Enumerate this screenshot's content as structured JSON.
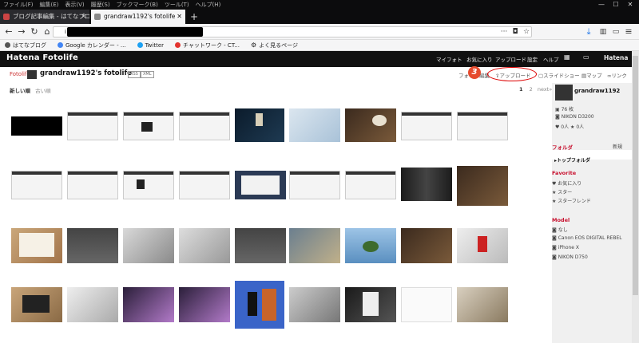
{
  "menu": [
    "ファイル(F)",
    "編集(E)",
    "表示(V)",
    "履歴(S)",
    "ブックマーク(B)",
    "ツール(T)",
    "ヘルプ(H)"
  ],
  "tabs": [
    {
      "label": "ブログ記事編集 - はてなブログ",
      "active": false
    },
    {
      "label": "grandraw1192's fotolife",
      "active": true
    }
  ],
  "new_tab": "+",
  "url_prefix": "i",
  "bookmarks": [
    "はてなブログ",
    "Google カレンダー - ...",
    "Twitter",
    "チャットワーク - CT...",
    "よく見るページ"
  ],
  "site": {
    "logo": "Hatena Fotolife",
    "header_links": [
      "マイフォト",
      "お気に入り",
      "アップロード",
      "設定",
      "ヘルプ"
    ],
    "hatena_label": "Hatena"
  },
  "subheader": {
    "crumb": "Fotolife",
    "title": "grandraw1192's fotolife",
    "tags": [
      "RSS",
      "XML"
    ],
    "tools": [
      "フォト",
      "編集",
      "アップロード",
      "スライドショー",
      "マップ",
      "リンク"
    ],
    "annotation_number": "3"
  },
  "sort": {
    "newest": "新しい順",
    "oldest": "古い順"
  },
  "pager": {
    "current": "1",
    "page2": "2",
    "next": "next»"
  },
  "sidebar": {
    "user": "grandraw1192",
    "count": "76 枚",
    "camera": "NIKON D3200",
    "stat1": "0人",
    "stat2": "0人",
    "folder_head": "フォルダ",
    "new_folder": "新規",
    "folder": "トップフォルダ",
    "favorite_head": "Favorite",
    "favorites": [
      "お気に入り",
      "スター",
      "スターフレンド"
    ],
    "model_head": "Model",
    "models": [
      "なし",
      "Canon EOS DIGITAL REBEL",
      "iPhone X",
      "NIKON D750"
    ]
  },
  "thumbnails": [
    "black-image",
    "website-screenshot",
    "website-screenshot",
    "website-screenshot",
    "paper-tag-photo",
    "flowchart-photo",
    "photo-with-text",
    "bicycle-photo",
    "website-screenshot",
    "website-screenshot",
    "website-screenshot",
    "website-screenshot",
    "website-screenshot",
    "website-screenshot",
    "website-screenshot",
    "website-screenshot",
    "website-screenshot",
    "business-suit-photo",
    "photo-with-text",
    "notebook-photo",
    "crowd-photo",
    "desk-photo",
    "desk-photo",
    "crowd-photo",
    "woman-with-text",
    "island-photo",
    "bicycle-photo",
    "flower-pot-photo",
    "wallet-photo",
    "pen-photo",
    "purple-document-photo",
    "purple-document-photo",
    "running-man-illustration",
    "hands-laptop-photo",
    "shirt-photo",
    "blank-page",
    "office-desk-photo"
  ]
}
